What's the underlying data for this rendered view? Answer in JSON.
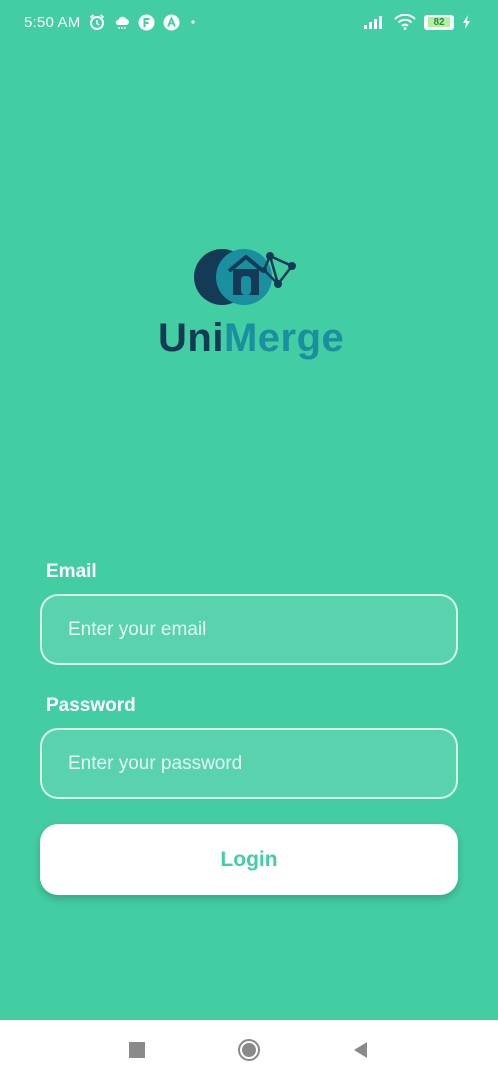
{
  "status_bar": {
    "time": "5:50 AM",
    "battery_level": "82",
    "icons": [
      "alarm-icon",
      "cloud-icon",
      "app-f-icon",
      "app-a-icon",
      "dot-icon",
      "signal-icon",
      "wifi-icon",
      "battery-icon",
      "charging-icon"
    ]
  },
  "logo": {
    "text_part1": "Uni",
    "text_part2": "Merge",
    "icon": "house-network-icon",
    "colors": {
      "dark": "#153a55",
      "teal": "#1a8fa0"
    }
  },
  "form": {
    "email_label": "Email",
    "email_placeholder": "Enter your email",
    "email_value": "",
    "password_label": "Password",
    "password_placeholder": "Enter your password",
    "password_value": "",
    "login_label": "Login"
  },
  "nav_bar": {
    "icons": [
      "recents-square-icon",
      "home-circle-icon",
      "back-triangle-icon"
    ]
  },
  "colors": {
    "background": "#43cda3",
    "button_text": "#43cda3",
    "nav_bg": "#ffffff"
  }
}
